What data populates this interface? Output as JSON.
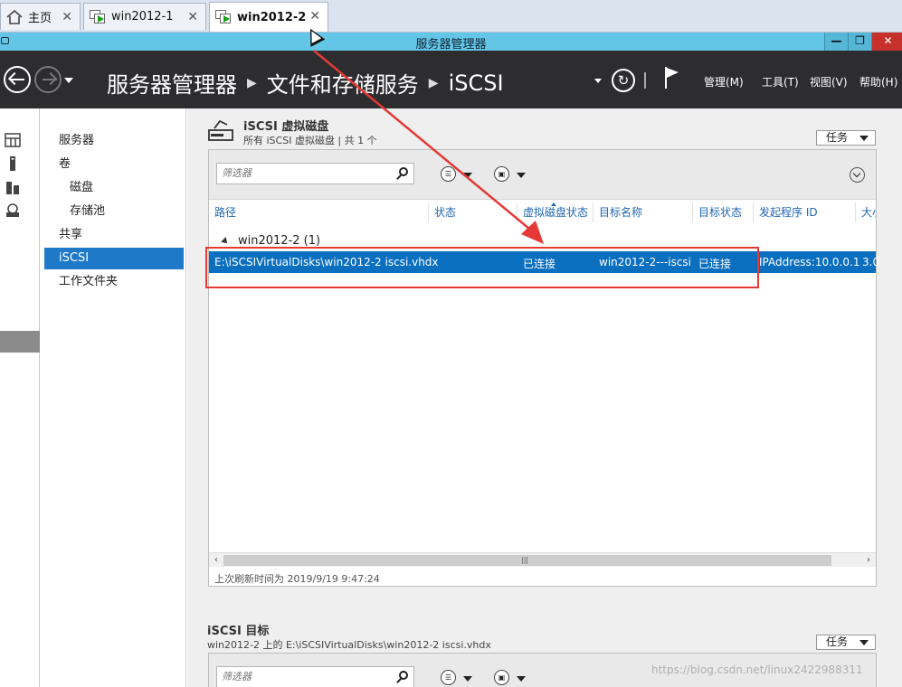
{
  "tabs": [
    {
      "label": "主页",
      "icon": "home-icon"
    },
    {
      "label": "win2012-1",
      "icon": "vm-icon"
    },
    {
      "label": "win2012-2",
      "icon": "vm-icon",
      "active": true
    }
  ],
  "window": {
    "title": "服务器管理器"
  },
  "header": {
    "breadcrumbs": [
      "服务器管理器",
      "文件和存储服务",
      "iSCSI"
    ],
    "menus": [
      "管理(M)",
      "工具(T)",
      "视图(V)",
      "帮助(H)"
    ]
  },
  "nav": {
    "items": [
      {
        "label": "服务器",
        "level": 0
      },
      {
        "label": "卷",
        "level": 0
      },
      {
        "label": "磁盘",
        "level": 1
      },
      {
        "label": "存储池",
        "level": 1
      },
      {
        "label": "共享",
        "level": 0
      },
      {
        "label": "iSCSI",
        "level": 0,
        "selected": true
      },
      {
        "label": "工作文件夹",
        "level": 0
      }
    ]
  },
  "disks_section": {
    "title": "iSCSI 虚拟磁盘",
    "subtitle": "所有 iSCSI 虚拟磁盘 | 共 1 个",
    "tasks_label": "任务",
    "filter_placeholder": "筛选器",
    "columns": [
      "路径",
      "状态",
      "虚拟磁盘状态",
      "目标名称",
      "目标状态",
      "发起程序 ID",
      "大小"
    ],
    "group_label": "win2012-2 (1)",
    "row": {
      "path": "E:\\iSCSIVirtualDisks\\win2012-2 iscsi.vhdx",
      "status": "",
      "disk_status": "已连接",
      "target_name": "win2012-2---iscsi",
      "target_status": "已连接",
      "initiator_id": "IPAddress:10.0.0.1",
      "size": "3.0"
    },
    "last_refresh": "上次刷新时间为 2019/9/19 9:47:24"
  },
  "targets_section": {
    "title": "iSCSI 目标",
    "subtitle": "win2012-2 上的 E:\\iSCSIVirtualDisks\\win2012-2 iscsi.vhdx",
    "tasks_label": "任务",
    "filter_placeholder": "筛选器"
  },
  "watermark": "https://blog.csdn.net/linux2422988311",
  "colors": {
    "accent": "#1f79c9",
    "selection": "#0b6fc0",
    "annotation": "#e53935",
    "titlebar": "#63c6e7"
  }
}
